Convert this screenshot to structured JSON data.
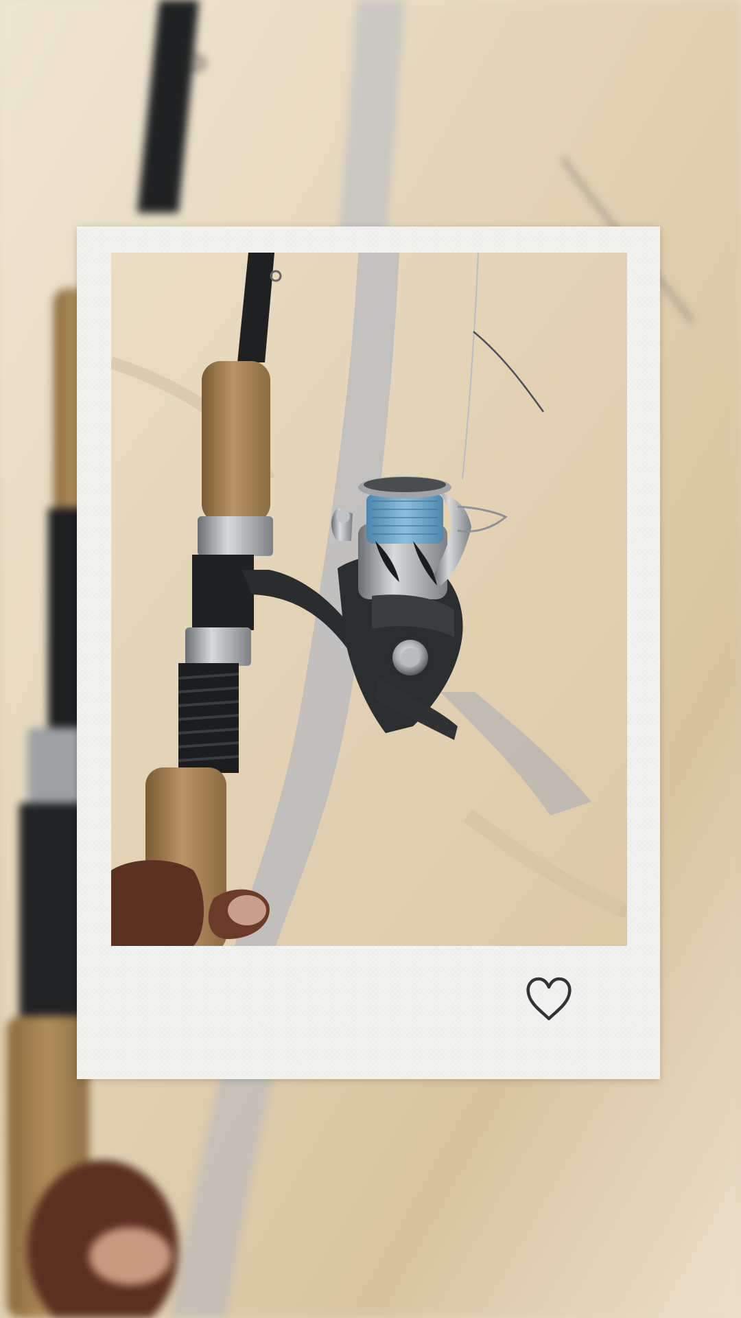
{
  "scene": {
    "subject": "spinning-rod-and-reel",
    "frame_style": "polaroid",
    "accent_colors": {
      "fabric": "#e6d8bd",
      "cork": "#a88656",
      "rod_blank": "#222426",
      "reel_silver": "#b8bcc0",
      "braided_line": "#6aa3c8",
      "frame": "#f3f3f1",
      "heart_stroke": "#333333"
    }
  },
  "decoration": {
    "icon": "heart-outline-icon"
  }
}
